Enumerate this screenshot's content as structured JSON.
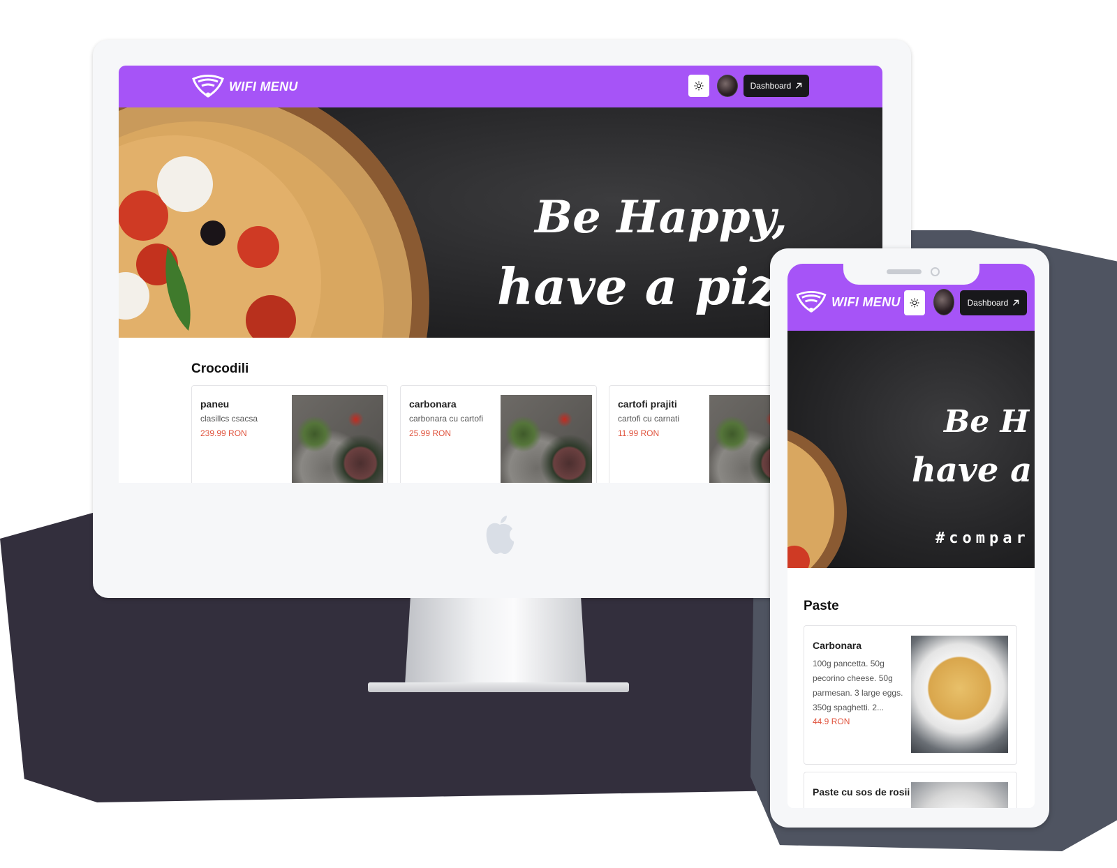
{
  "brand": {
    "name": "WIFI MENU",
    "accent": "#a654f7",
    "price_color": "#e0533d"
  },
  "desktop": {
    "navbar": {
      "theme_toggle_icon": "sun-icon",
      "dashboard_label": "Dashboard",
      "dashboard_icon": "arrow-up-right-icon"
    },
    "hero": {
      "line1": "Be Happy,",
      "line2": "have a pizza"
    },
    "section": {
      "title": "Crocodili",
      "items": [
        {
          "name": "paneu",
          "description": "clasillcs csacsa",
          "price": "239.99 RON"
        },
        {
          "name": "carbonara",
          "description": "carbonara cu cartofi",
          "price": "25.99 RON"
        },
        {
          "name": "cartofi prajiti",
          "description": "cartofi cu carnati",
          "price": "11.99 RON"
        }
      ]
    }
  },
  "mobile": {
    "navbar": {
      "theme_toggle_icon": "sun-icon",
      "dashboard_label": "Dashboard",
      "dashboard_icon": "arrow-up-right-icon"
    },
    "hero": {
      "line1": "Be H",
      "line2": "have a p",
      "tag": "#compar"
    },
    "section": {
      "title": "Paste",
      "items": [
        {
          "name": "Carbonara",
          "description_lines": [
            "100g pancetta. 50g",
            "pecorino cheese. 50g",
            "parmesan. 3 large eggs.",
            "350g spaghetti. 2..."
          ],
          "price": "44.9 RON"
        },
        {
          "name": "Paste cu sos de rosii"
        }
      ]
    }
  }
}
